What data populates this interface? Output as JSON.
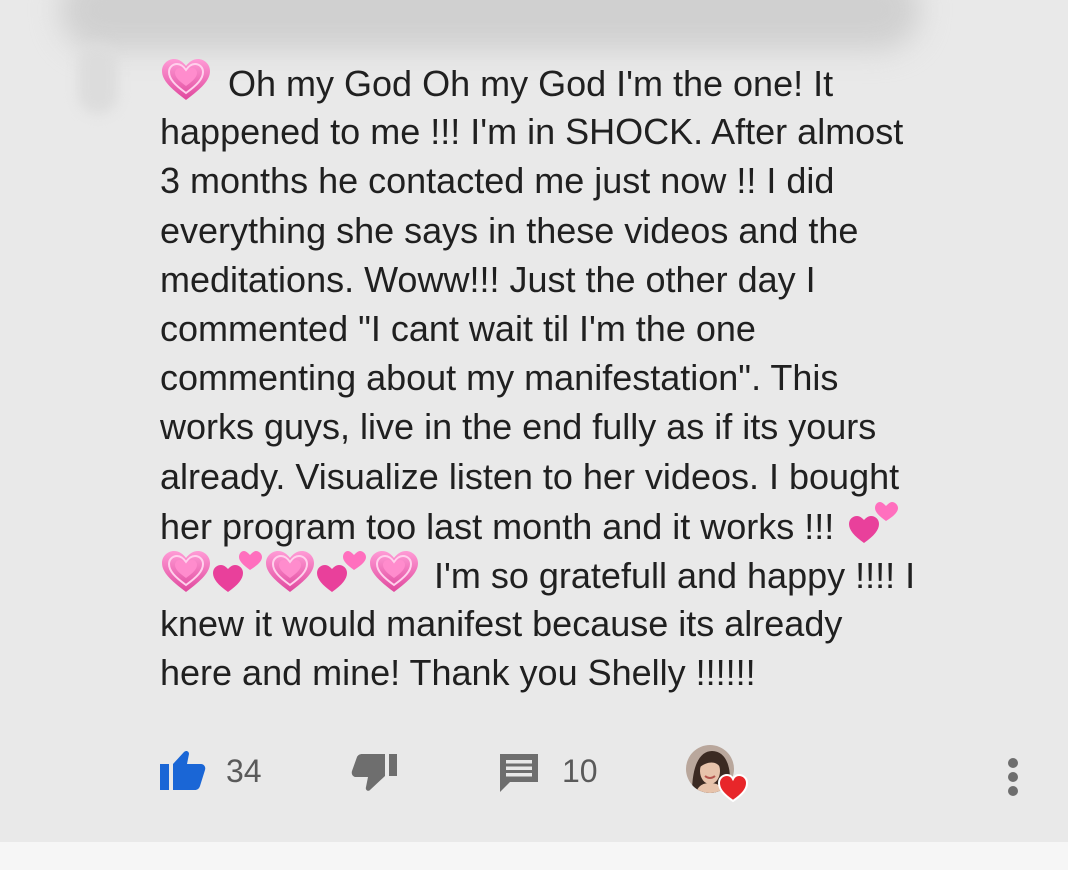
{
  "comment": {
    "lines": [
      "Oh my God Oh my God I'm the one! It",
      "happened to me !!! I'm in SHOCK. After almost",
      "3 months he contacted me just now !! I did",
      "everything she says in these videos and the",
      "meditations. Woww!!! Just the other day I",
      "commented \"I cant wait til I'm the one",
      "commenting about my manifestation\". This",
      "works guys, live in the end fully as if its yours",
      "already. Visualize listen to her videos. I bought",
      "her program too last month and it works !!!",
      "I'm so gratefull and happy !!!! I",
      "knew it would manifest because its already",
      "here and mine! Thank you Shelly !!!!!!"
    ],
    "emojis": [
      "growing-heart",
      "two-hearts"
    ]
  },
  "actions": {
    "like_count": "34",
    "reply_count": "10",
    "like_icon": "thumbs-up-icon",
    "dislike_icon": "thumbs-down-icon",
    "reply_icon": "comment-icon",
    "creator_heart_icon": "heart-icon",
    "more_icon": "more-vertical-icon"
  },
  "colors": {
    "background": "#e9e9e9",
    "text": "#202020",
    "like_active": "#1a66d6",
    "icon_gray": "#6e6e6e",
    "heart_red": "#e8262a",
    "emoji_pink": "#f06bb3"
  }
}
